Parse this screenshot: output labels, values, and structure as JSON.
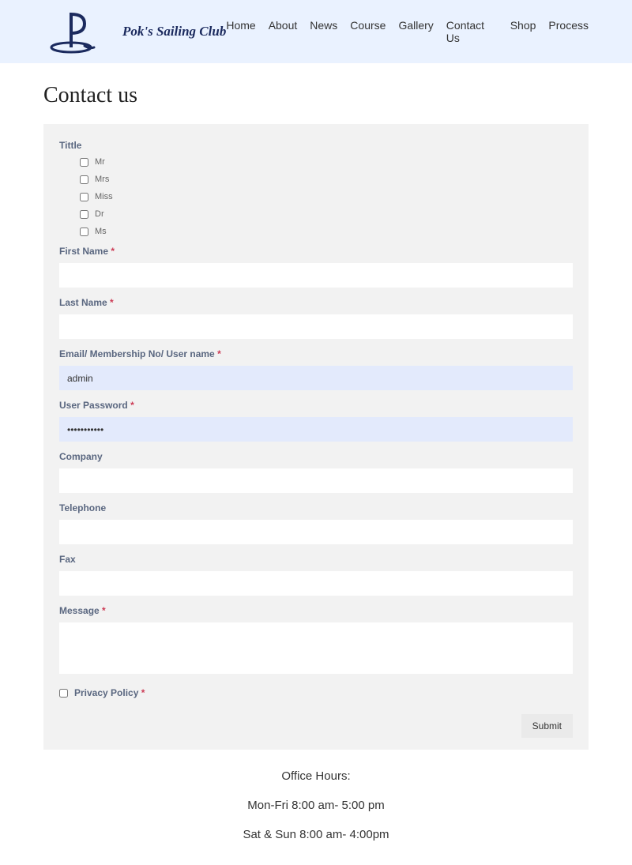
{
  "header": {
    "site_title": "Pok's Sailing Club",
    "nav": [
      "Home",
      "About",
      "News",
      "Course",
      "Gallery",
      "Contact Us",
      "Shop",
      "Process"
    ]
  },
  "page": {
    "title": "Contact us"
  },
  "form": {
    "title_label": "Tittle",
    "title_options": [
      "Mr",
      "Mrs",
      "Miss",
      "Dr",
      "Ms"
    ],
    "first_name_label": "First Name",
    "last_name_label": "Last Name",
    "email_label": "Email/ Membership No/ User name",
    "email_value": "admin",
    "password_label": "User Password",
    "password_value": "•••••••••••",
    "company_label": "Company",
    "telephone_label": "Telephone",
    "fax_label": "Fax",
    "message_label": "Message",
    "privacy_label": "Privacy Policy",
    "submit_label": "Submit",
    "asterisk": "*"
  },
  "hours": {
    "heading": "Office Hours:",
    "weekday": "Mon-Fri 8:00 am- 5:00 pm",
    "weekend": "Sat & Sun 8:00 am- 4:00pm"
  }
}
